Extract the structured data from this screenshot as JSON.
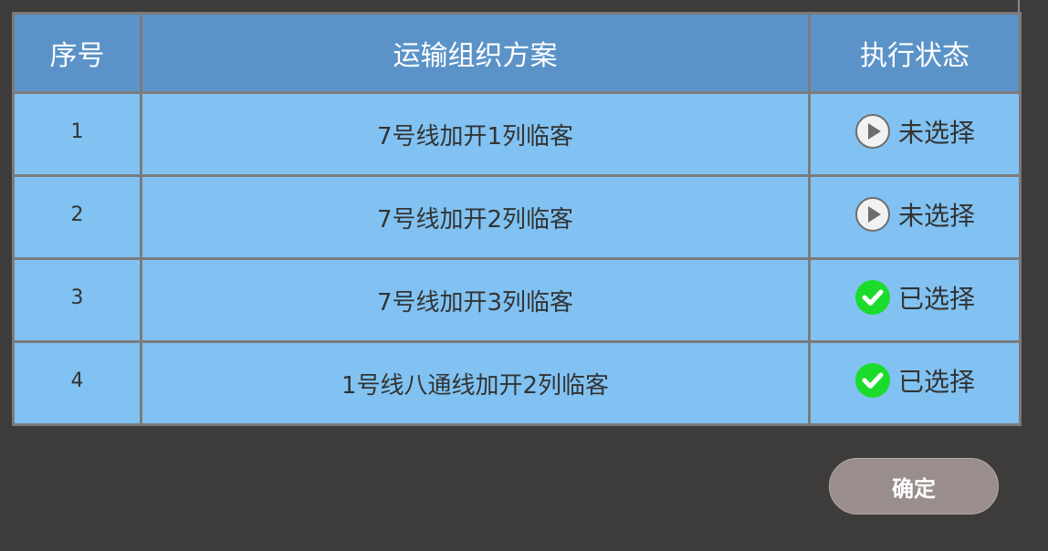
{
  "table": {
    "headers": {
      "index": "序号",
      "plan": "运输组织方案",
      "status": "执行状态"
    },
    "rows": [
      {
        "index": "1",
        "plan": "7号线加开1列临客",
        "status": "未选择",
        "selected": false
      },
      {
        "index": "2",
        "plan": "7号线加开2列临客",
        "status": "未选择",
        "selected": false
      },
      {
        "index": "3",
        "plan": "7号线加开3列临客",
        "status": "已选择",
        "selected": true
      },
      {
        "index": "4",
        "plan": "1号线八通线加开2列临客",
        "status": "已选择",
        "selected": true
      }
    ]
  },
  "icons": {
    "unselected": "play-icon",
    "selected": "check-icon"
  },
  "colors": {
    "header_bg": "#5b93c8",
    "row_bg": "#81c2f2",
    "selected_green": "#1bdc2a",
    "button_bg": "#9a8e8d"
  },
  "footer": {
    "confirm_label": "确定"
  }
}
